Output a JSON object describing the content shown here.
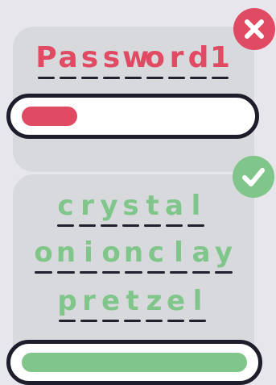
{
  "weak_example": {
    "password": "Password1",
    "strength_fraction": 0.25,
    "status_icon": "x-icon",
    "color": "#e04a62"
  },
  "strong_example": {
    "words": [
      "crystal",
      "onionclay",
      "pretzel"
    ],
    "strength_fraction": 1.0,
    "status_icon": "check-icon",
    "color": "#80c58a"
  },
  "colors": {
    "background": "#e6e6ec",
    "card": "#d8d9dc",
    "outline": "#1d1d2b",
    "weak": "#e04a62",
    "strong": "#80c58a"
  }
}
